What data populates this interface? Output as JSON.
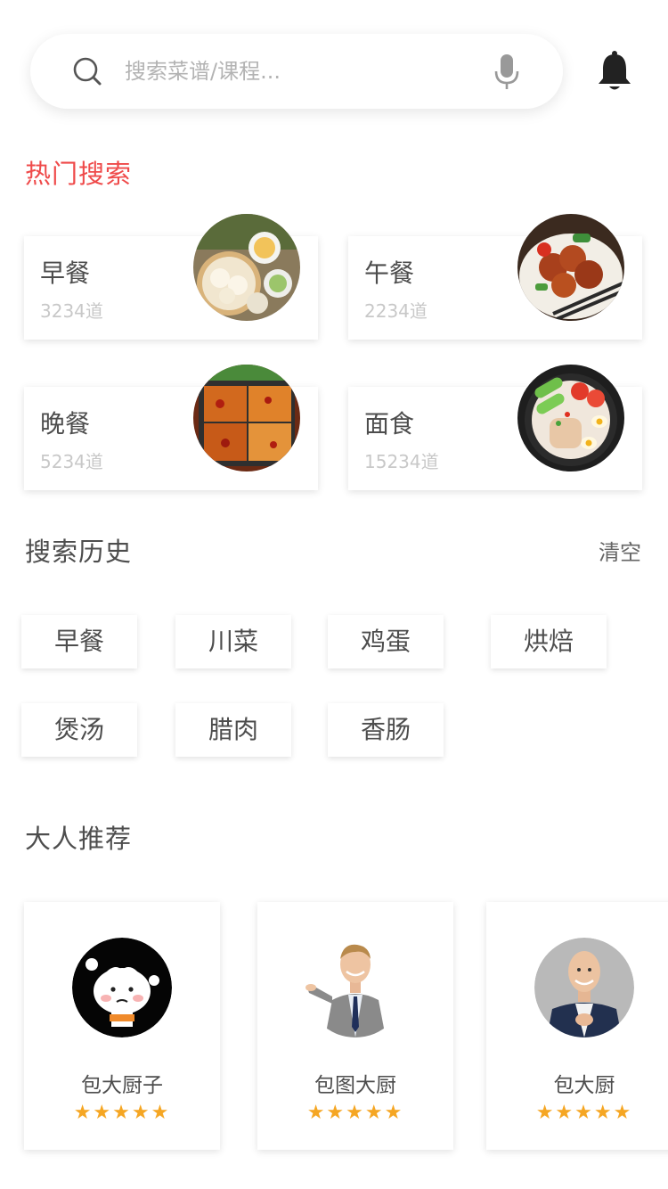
{
  "search": {
    "placeholder": "搜索菜谱/课程..."
  },
  "hot": {
    "title": "热门搜索",
    "items": [
      {
        "name": "早餐",
        "count": "3234道"
      },
      {
        "name": "午餐",
        "count": "2234道"
      },
      {
        "name": "晚餐",
        "count": "5234道"
      },
      {
        "name": "面食",
        "count": "15234道"
      }
    ]
  },
  "history": {
    "title": "搜索历史",
    "clear_label": "清空",
    "tags": [
      "早餐",
      "川菜",
      "鸡蛋",
      "烘焙",
      "煲汤",
      "腊肉",
      "香肠"
    ]
  },
  "recommend": {
    "title": "大人推荐",
    "chefs": [
      {
        "name": "包大厨子",
        "stars": "★★★★★",
        "rating": 5
      },
      {
        "name": "包图大厨",
        "stars": "★★★★★",
        "rating": 5
      },
      {
        "name": "包大厨",
        "stars": "★★★★★",
        "rating": 5
      }
    ]
  },
  "colors": {
    "accent": "#ef4a4a",
    "star": "#f5a623",
    "text": "#4d4d4d",
    "muted": "#c8c8c8"
  },
  "icons": {
    "search": "search-icon",
    "mic": "microphone-icon",
    "bell": "bell-icon"
  }
}
